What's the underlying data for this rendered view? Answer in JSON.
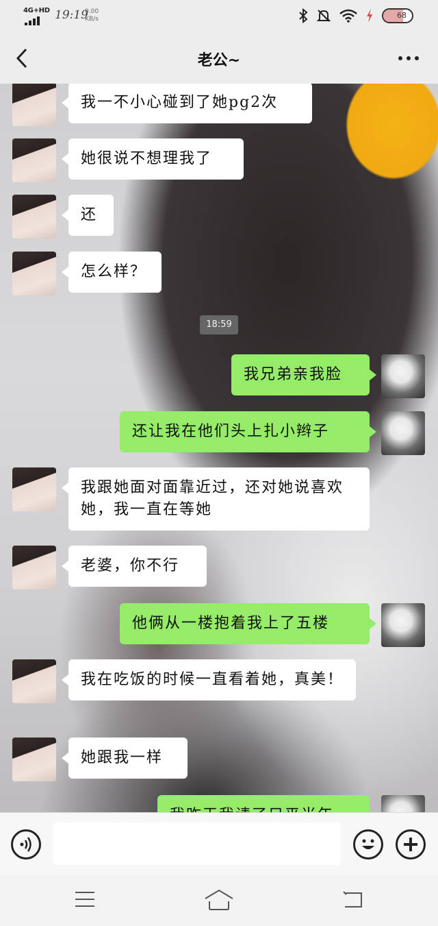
{
  "status_bar": {
    "network": "4G+HD",
    "time": "19:19",
    "speed_value": "0.00",
    "speed_unit": "KB/s",
    "battery": "68",
    "battery_level": 0.68,
    "icons": [
      "bluetooth-icon",
      "mute-icon",
      "wifi-icon",
      "charging-icon",
      "battery-icon"
    ]
  },
  "header": {
    "title": "老公~",
    "back_icon": "chevron-left-icon",
    "more_icon": "more-dots-icon"
  },
  "chat": {
    "timestamp": "18:59",
    "messages": [
      {
        "side": "in",
        "text": "我一不小心碰到了她pg2次"
      },
      {
        "side": "in",
        "text": "她很说不想理我了"
      },
      {
        "side": "in",
        "text": "还"
      },
      {
        "side": "in",
        "text": "怎么样？"
      },
      {
        "side": "out",
        "text": "我兄弟亲我脸"
      },
      {
        "side": "out",
        "text": "还让我在他们头上扎小辫子"
      },
      {
        "side": "in",
        "text": "我跟她面对面靠近过，还对她说喜欢她，我一直在等她"
      },
      {
        "side": "in",
        "text": "老婆，你不行"
      },
      {
        "side": "out",
        "text": "他俩从一楼抱着我上了五楼"
      },
      {
        "side": "in",
        "text": "我在吃饭的时候一直看着她，真美！"
      },
      {
        "side": "in",
        "text": "她跟我一样"
      },
      {
        "side": "out",
        "text": "我昨天我请了只平当年"
      }
    ]
  },
  "input_bar": {
    "voice_icon": "voice-icon",
    "placeholder": "",
    "emoji_icon": "emoji-icon",
    "plus_icon": "plus-icon"
  },
  "nav_bar": {
    "icons": [
      "menu-icon",
      "home-icon",
      "back-icon"
    ]
  }
}
